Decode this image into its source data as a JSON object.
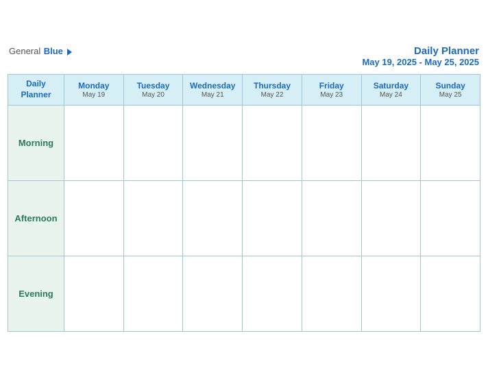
{
  "logo": {
    "general": "General",
    "blue": "Blue"
  },
  "header": {
    "title": "Daily Planner",
    "date_range": "May 19, 2025 - May 25, 2025"
  },
  "table": {
    "corner_label_line1": "Daily",
    "corner_label_line2": "Planner",
    "columns": [
      {
        "day": "Monday",
        "date": "May 19"
      },
      {
        "day": "Tuesday",
        "date": "May 20"
      },
      {
        "day": "Wednesday",
        "date": "May 21"
      },
      {
        "day": "Thursday",
        "date": "May 22"
      },
      {
        "day": "Friday",
        "date": "May 23"
      },
      {
        "day": "Saturday",
        "date": "May 24"
      },
      {
        "day": "Sunday",
        "date": "May 25"
      }
    ],
    "rows": [
      {
        "label": "Morning"
      },
      {
        "label": "Afternoon"
      },
      {
        "label": "Evening"
      }
    ]
  }
}
